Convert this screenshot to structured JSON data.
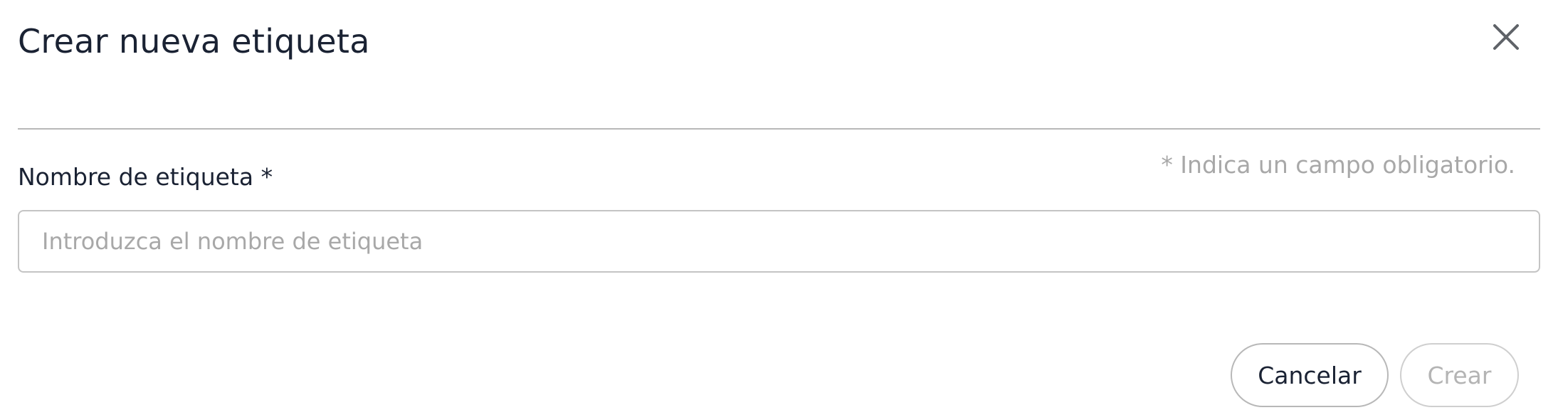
{
  "dialog": {
    "title": "Crear nueva etiqueta",
    "close_icon": "close-icon",
    "required_note": "* Indica un campo obligatorio.",
    "field": {
      "label": "Nombre de etiqueta *",
      "value": "",
      "placeholder": "Introduzca el nombre de etiqueta"
    },
    "buttons": {
      "cancel": "Cancelar",
      "create": "Crear",
      "create_disabled": true
    }
  },
  "colors": {
    "text": "#1a2233",
    "muted": "#a8a8a8",
    "border": "#c4c4c4",
    "divider": "#b8b8b8"
  }
}
